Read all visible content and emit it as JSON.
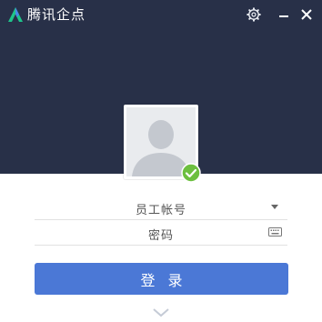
{
  "titlebar": {
    "title": "腾讯企点",
    "logo_icon": "qidian-logo-icon",
    "settings_icon": "gear-icon",
    "minimize_icon": "minimize-icon",
    "close_icon": "close-icon"
  },
  "avatar": {
    "icon": "default-user-silhouette-icon",
    "status_icon": "check-circle-icon",
    "status_color": "#6cbf3f"
  },
  "form": {
    "account_placeholder": "员工帐号",
    "password_placeholder": "密码",
    "account_dropdown_icon": "caret-down-icon",
    "keyboard_icon": "keyboard-icon"
  },
  "login_button": {
    "label": "登录"
  },
  "more_options_icon": "chevron-down-icon",
  "colors": {
    "header_bg": "#283048",
    "accent": "#4b78d6",
    "logo_green": "#1fc48b"
  }
}
